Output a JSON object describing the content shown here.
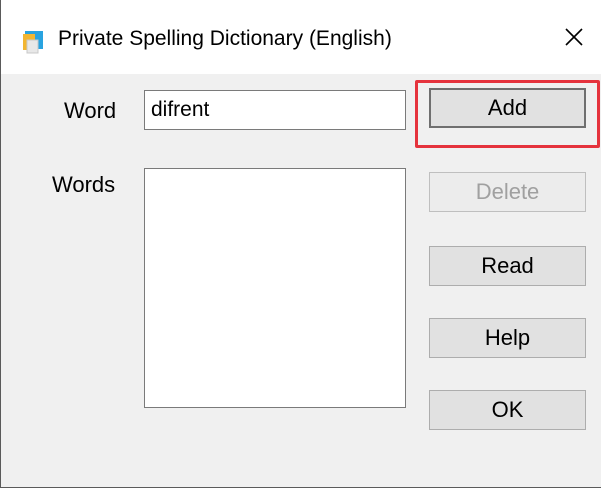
{
  "window": {
    "title": "Private Spelling Dictionary (English)",
    "icon": "dictionary-app-icon",
    "close_icon": "close-icon"
  },
  "form": {
    "word_label": "Word",
    "word_value": "difrent",
    "words_label": "Words",
    "words_list": []
  },
  "buttons": {
    "add": "Add",
    "delete": "Delete",
    "read": "Read",
    "help": "Help",
    "ok": "OK"
  },
  "colors": {
    "highlight": "#e5333d",
    "disabled_text": "#a0a0a0"
  }
}
